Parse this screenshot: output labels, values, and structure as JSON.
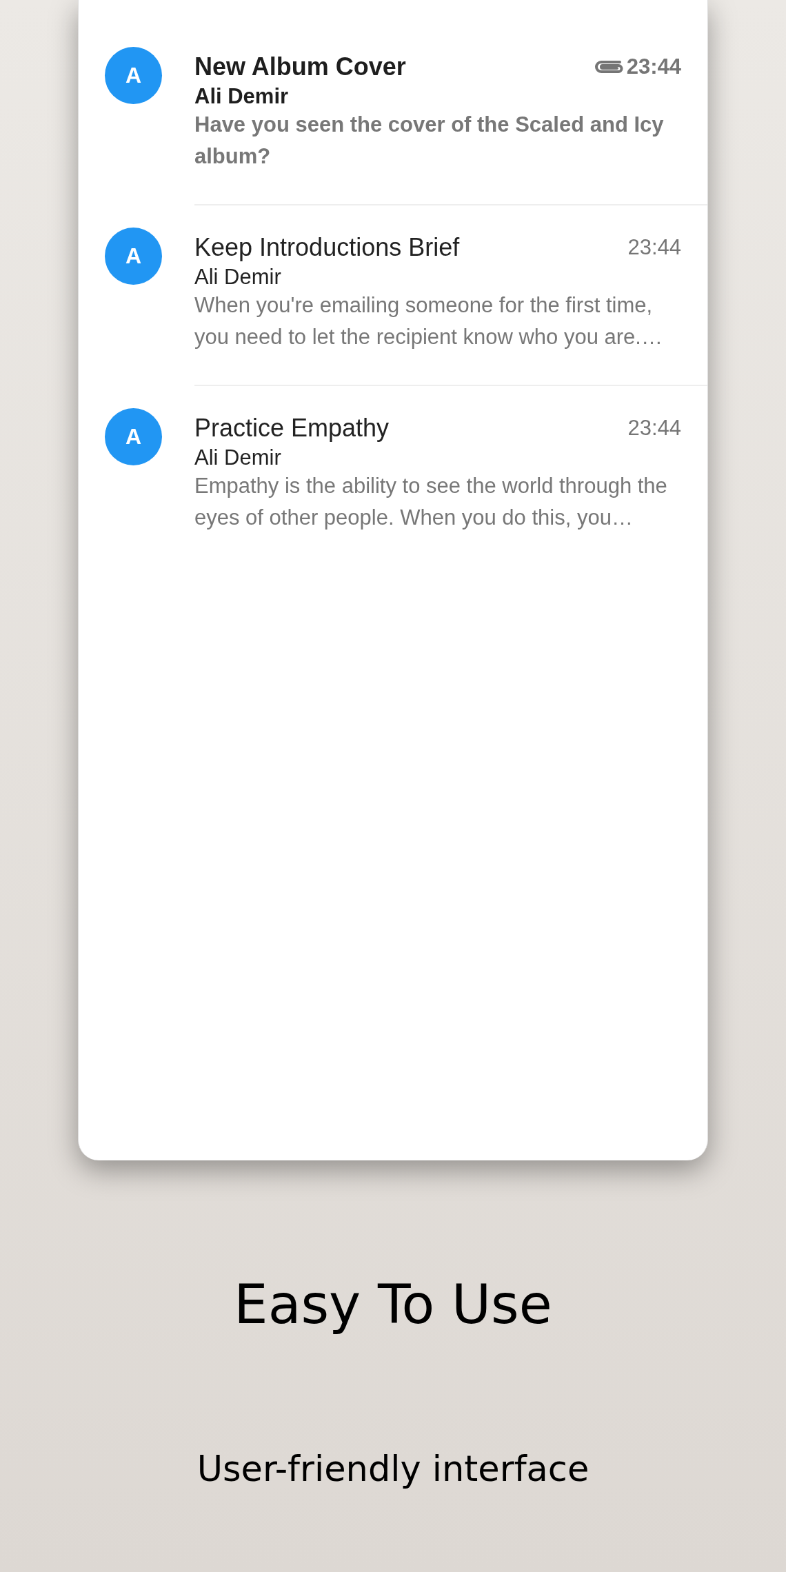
{
  "messages": [
    {
      "avatar": "A",
      "subject": "New Album Cover",
      "sender": "Ali Demir",
      "preview": "Have you seen the cover of the Scaled and Icy album?",
      "time": "23:44",
      "unread": true,
      "has_attachment": true
    },
    {
      "avatar": "A",
      "subject": "Keep Introductions Brief",
      "sender": "Ali Demir",
      "preview": "When you're emailing someone for the first time, you need to let the recipient know who you are.…",
      "time": "23:44",
      "unread": false,
      "has_attachment": false
    },
    {
      "avatar": "A",
      "subject": "Practice Empathy",
      "sender": "Ali Demir",
      "preview": "Empathy is the ability to see the world through the eyes of other people. When you do this, you…",
      "time": "23:44",
      "unread": false,
      "has_attachment": false
    }
  ],
  "headline": "Easy To Use",
  "subtitle": "User-friendly interface"
}
